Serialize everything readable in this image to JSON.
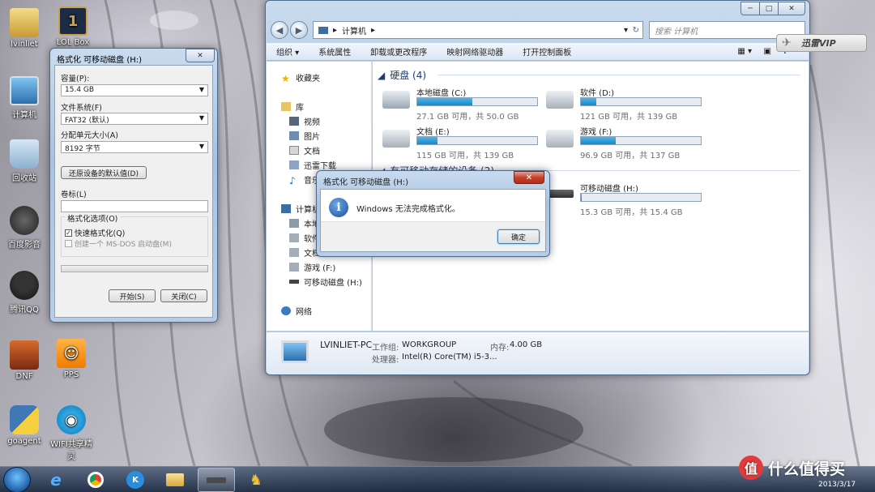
{
  "desktop": {
    "icons": [
      {
        "label": "lvinliet"
      },
      {
        "label": "LOL Box"
      },
      {
        "label": "计算机"
      },
      {
        "label": "回收站"
      },
      {
        "label": "百度影音"
      },
      {
        "label": "腾讯QQ"
      },
      {
        "label": "DNF"
      },
      {
        "label": "PPS"
      },
      {
        "label": "goagent"
      },
      {
        "label": "WIFI共享精灵"
      }
    ]
  },
  "explorer": {
    "breadcrumb_root": "计算机",
    "search_placeholder": "搜索 计算机",
    "toolbar": [
      "组织 ▾",
      "系统属性",
      "卸载或更改程序",
      "映射网络驱动器",
      "打开控制面板"
    ],
    "sidebar": {
      "favorites": "收藏夹",
      "libraries": "库",
      "lib_items": [
        "视频",
        "图片",
        "文档",
        "迅雷下载",
        "音乐"
      ],
      "computer": "计算机",
      "computer_items": [
        "本地",
        "软件",
        "文档",
        "游戏 (F:)",
        "可移动磁盘 (H:)"
      ],
      "network": "网络"
    },
    "hard_disks_header": "硬盘 (4)",
    "removable_header": "有可移动存储的设备 (2)",
    "drives": [
      {
        "name": "本地磁盘 (C:)",
        "size": "27.1 GB 可用，共 50.0 GB",
        "used_fraction": 0.46
      },
      {
        "name": "软件 (D:)",
        "size": "121 GB 可用，共 139 GB",
        "used_fraction": 0.13
      },
      {
        "name": "文档 (E:)",
        "size": "115 GB 可用，共 139 GB",
        "used_fraction": 0.17
      },
      {
        "name": "游戏 (F:)",
        "size": "96.9 GB 可用，共 137 GB",
        "used_fraction": 0.29
      },
      {
        "name": "可移动磁盘 (H:)",
        "size": "15.3 GB 可用，共 15.4 GB",
        "used_fraction": 0.01
      }
    ],
    "details": {
      "pc_name": "LVINLIET-PC",
      "workgroup_label": "工作组:",
      "workgroup": "WORKGROUP",
      "memory_label": "内存:",
      "memory": "4.00 GB",
      "cpu_label": "处理器:",
      "cpu": "Intel(R) Core(TM) i5-3..."
    }
  },
  "format_dialog": {
    "title": "格式化 可移动磁盘 (H:)",
    "capacity_label": "容量(P):",
    "capacity": "15.4 GB",
    "fs_label": "文件系统(F)",
    "fs": "FAT32 (默认)",
    "alloc_label": "分配单元大小(A)",
    "alloc": "8192 字节",
    "restore_button": "还原设备的默认值(D)",
    "volume_label": "卷标(L)",
    "volume_value": "",
    "options_label": "格式化选项(O)",
    "quick_format": "快速格式化(Q)",
    "msdos": "创建一个 MS-DOS 启动盘(M)",
    "start_button": "开始(S)",
    "close_button": "关闭(C)"
  },
  "error_dialog": {
    "title": "格式化 可移动磁盘 (H:)",
    "message": "Windows 无法完成格式化。",
    "ok_button": "确定"
  },
  "vip_badge": "迅雷VIP",
  "watermark": "什么值得买",
  "watermark_badge": "值",
  "clock": "2013/3/17",
  "colors": {
    "drive_fill": "#1b86c6",
    "taskbar": "#1f3556",
    "accent": "#4b6a8c"
  }
}
